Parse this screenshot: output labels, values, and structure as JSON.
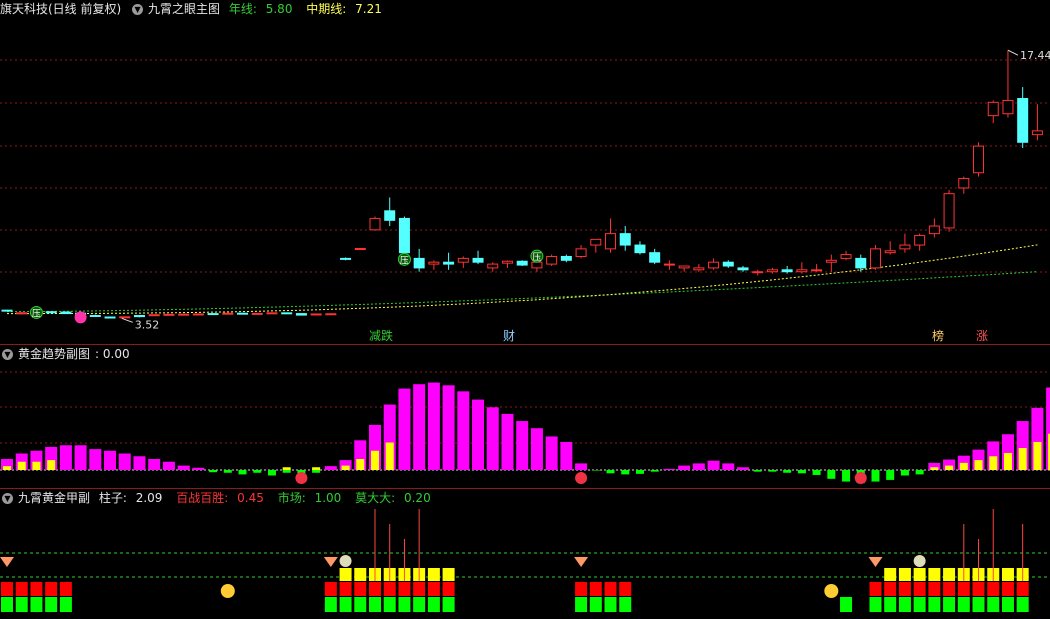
{
  "main": {
    "header": {
      "stock": "旗天科技(日线 前复权)",
      "indicator": "九霄之眼主图",
      "line1_label": "年线:",
      "line1_value": "5.80",
      "line2_label": "中期线:",
      "line2_value": "7.21"
    },
    "high_label": "17.44",
    "low_label": "3.52",
    "markers": {
      "ya": "压",
      "cai": "财"
    },
    "signals": [
      "减跌",
      "财",
      "榜",
      "涨"
    ]
  },
  "sub1": {
    "header": {
      "name": "黄金趋势副图",
      "value": ": 0.00"
    }
  },
  "sub2": {
    "header": {
      "name": "九霄黄金甲副",
      "k1": "柱子:",
      "v1": "2.09",
      "k2": "百战百胜:",
      "v2": "0.45",
      "k3": "市场:",
      "v3": "1.00",
      "k4": "莫大大:",
      "v4": "0.20"
    }
  },
  "colors": {
    "up": "#ff3333",
    "down": "#54ffff",
    "magenta": "#ff00ff",
    "yellow": "#ffff00",
    "green": "#00ff00",
    "red": "#ff0000",
    "border": "#8b1a1a",
    "grid": "#8b1a1a"
  },
  "chart_data": [
    {
      "type": "candlestick",
      "title": "九霄之眼主图",
      "ylim": [
        3.0,
        18.5
      ],
      "ohlc": [
        [
          3.78,
          3.8,
          3.72,
          3.75
        ],
        [
          3.62,
          3.7,
          3.55,
          3.64
        ],
        [
          3.75,
          3.82,
          3.72,
          3.8
        ],
        [
          3.7,
          3.72,
          3.62,
          3.64
        ],
        [
          3.68,
          3.72,
          3.58,
          3.6
        ],
        [
          3.62,
          3.64,
          3.55,
          3.6
        ],
        [
          3.5,
          3.55,
          3.45,
          3.48
        ],
        [
          3.42,
          3.45,
          3.35,
          3.38
        ],
        [
          3.4,
          3.45,
          3.38,
          3.43
        ],
        [
          3.5,
          3.52,
          3.4,
          3.44
        ],
        [
          3.52,
          3.55,
          3.5,
          3.54
        ],
        [
          3.55,
          3.57,
          3.52,
          3.56
        ],
        [
          3.56,
          3.58,
          3.54,
          3.57
        ],
        [
          3.57,
          3.6,
          3.55,
          3.58
        ],
        [
          3.6,
          3.62,
          3.57,
          3.59
        ],
        [
          3.6,
          3.64,
          3.58,
          3.62
        ],
        [
          3.62,
          3.64,
          3.58,
          3.61
        ],
        [
          3.6,
          3.62,
          3.57,
          3.61
        ],
        [
          3.62,
          3.66,
          3.6,
          3.64
        ],
        [
          3.64,
          3.66,
          3.6,
          3.63
        ],
        [
          3.6,
          3.62,
          3.5,
          3.52
        ],
        [
          3.55,
          3.6,
          3.52,
          3.58
        ],
        [
          3.58,
          3.62,
          3.55,
          3.59
        ],
        [
          6.5,
          6.55,
          6.4,
          6.45
        ],
        [
          7.0,
          7.05,
          6.95,
          7.02
        ],
        [
          8.0,
          8.7,
          7.95,
          8.6
        ],
        [
          9.0,
          9.7,
          8.2,
          8.5
        ],
        [
          8.6,
          8.7,
          6.6,
          6.8
        ],
        [
          6.5,
          7.0,
          5.8,
          6.0
        ],
        [
          6.2,
          6.4,
          5.9,
          6.3
        ],
        [
          6.3,
          6.8,
          5.9,
          6.2
        ],
        [
          6.3,
          6.6,
          6.0,
          6.5
        ],
        [
          6.5,
          6.9,
          6.2,
          6.3
        ],
        [
          6.0,
          6.3,
          5.8,
          6.2
        ],
        [
          6.25,
          6.4,
          6.0,
          6.35
        ],
        [
          6.35,
          6.4,
          6.1,
          6.15
        ],
        [
          6.0,
          6.4,
          5.8,
          6.3
        ],
        [
          6.2,
          6.7,
          6.1,
          6.6
        ],
        [
          6.6,
          6.7,
          6.3,
          6.4
        ],
        [
          6.6,
          7.2,
          6.5,
          7.0
        ],
        [
          7.2,
          7.4,
          6.8,
          7.5
        ],
        [
          7.0,
          8.6,
          6.8,
          7.8
        ],
        [
          7.8,
          8.2,
          6.9,
          7.2
        ],
        [
          7.2,
          7.4,
          6.7,
          6.8
        ],
        [
          6.8,
          7.0,
          6.2,
          6.3
        ],
        [
          6.2,
          6.4,
          5.9,
          6.2
        ],
        [
          6.0,
          6.1,
          5.8,
          6.1
        ],
        [
          5.9,
          6.2,
          5.8,
          6.0
        ],
        [
          6.0,
          6.5,
          5.9,
          6.3
        ],
        [
          6.3,
          6.4,
          6.0,
          6.1
        ],
        [
          6.0,
          6.1,
          5.8,
          5.9
        ],
        [
          5.8,
          5.9,
          5.6,
          5.8
        ],
        [
          5.8,
          6.0,
          5.7,
          5.9
        ],
        [
          5.9,
          6.1,
          5.7,
          5.8
        ],
        [
          5.8,
          6.3,
          5.7,
          5.9
        ],
        [
          5.9,
          6.2,
          5.8,
          5.9
        ],
        [
          6.3,
          6.7,
          5.8,
          6.4
        ],
        [
          6.5,
          6.9,
          6.4,
          6.7
        ],
        [
          6.5,
          6.7,
          5.8,
          6.0
        ],
        [
          6.0,
          7.2,
          5.9,
          7.0
        ],
        [
          6.8,
          7.4,
          6.7,
          6.9
        ],
        [
          7.0,
          7.8,
          6.8,
          7.2
        ],
        [
          7.2,
          7.8,
          6.9,
          7.7
        ],
        [
          7.8,
          8.6,
          7.6,
          8.2
        ],
        [
          8.1,
          10.1,
          7.9,
          9.9
        ],
        [
          10.2,
          10.8,
          9.9,
          10.7
        ],
        [
          11.0,
          12.6,
          10.8,
          12.4
        ],
        [
          14.0,
          14.8,
          13.6,
          14.7
        ],
        [
          14.1,
          17.44,
          13.9,
          14.8
        ],
        [
          14.9,
          15.5,
          12.3,
          12.6
        ],
        [
          13.0,
          14.6,
          12.7,
          13.2
        ]
      ],
      "series": [
        {
          "name": "年线",
          "values_start": 3.7,
          "values_end": 5.8
        },
        {
          "name": "中期线",
          "values_start": 3.6,
          "values_end": 7.21
        }
      ]
    },
    {
      "type": "bar",
      "title": "黄金趋势副图",
      "series": [
        {
          "name": "magenta",
          "values": [
            2.0,
            3.0,
            3.5,
            4.2,
            4.5,
            4.5,
            3.8,
            3.5,
            3.0,
            2.5,
            2.0,
            1.5,
            0.8,
            0.4,
            -0.4,
            -0.5,
            -0.8,
            -0.5,
            -1.0,
            -0.5,
            -0.6,
            -0.5,
            0.7,
            1.8,
            5.4,
            8.2,
            11.9,
            14.8,
            15.6,
            15.9,
            15.4,
            14.3,
            12.8,
            11.4,
            10.2,
            8.9,
            7.6,
            6.1,
            5.1,
            1.2,
            -0.1,
            -0.6,
            -0.8,
            -0.7,
            -0.3,
            0.2,
            0.8,
            1.2,
            1.7,
            1.2,
            0.5,
            -0.3,
            -0.3,
            -0.5,
            -0.6,
            -0.9,
            -1.6,
            -2.1,
            -2.4,
            -2.1,
            -1.8,
            -1.0,
            -0.8,
            1.3,
            1.9,
            2.6,
            3.7,
            5.2,
            6.5,
            8.9,
            11.3,
            15.0,
            17.0,
            17.9,
            19.1
          ]
        },
        {
          "name": "yellow",
          "values": [
            0.7,
            1.5,
            1.5,
            1.8,
            0,
            0,
            0,
            0,
            0,
            0,
            0,
            0,
            0,
            0,
            0,
            0,
            0,
            0,
            0,
            0.5,
            0,
            0.5,
            0,
            0.8,
            2.0,
            3.5,
            5.0,
            0,
            0,
            0,
            0,
            0,
            0,
            0,
            0,
            0,
            0,
            0,
            0,
            0,
            0,
            0,
            0,
            0,
            0,
            0,
            0,
            0,
            0,
            0,
            0,
            0,
            0,
            0,
            0,
            0,
            0,
            0,
            0,
            0,
            0,
            0,
            0,
            0.5,
            0.8,
            1.3,
            1.8,
            2.5,
            3.1,
            4.0,
            5.1,
            6.6,
            7.3,
            7.5,
            7.9
          ]
        }
      ]
    }
  ]
}
